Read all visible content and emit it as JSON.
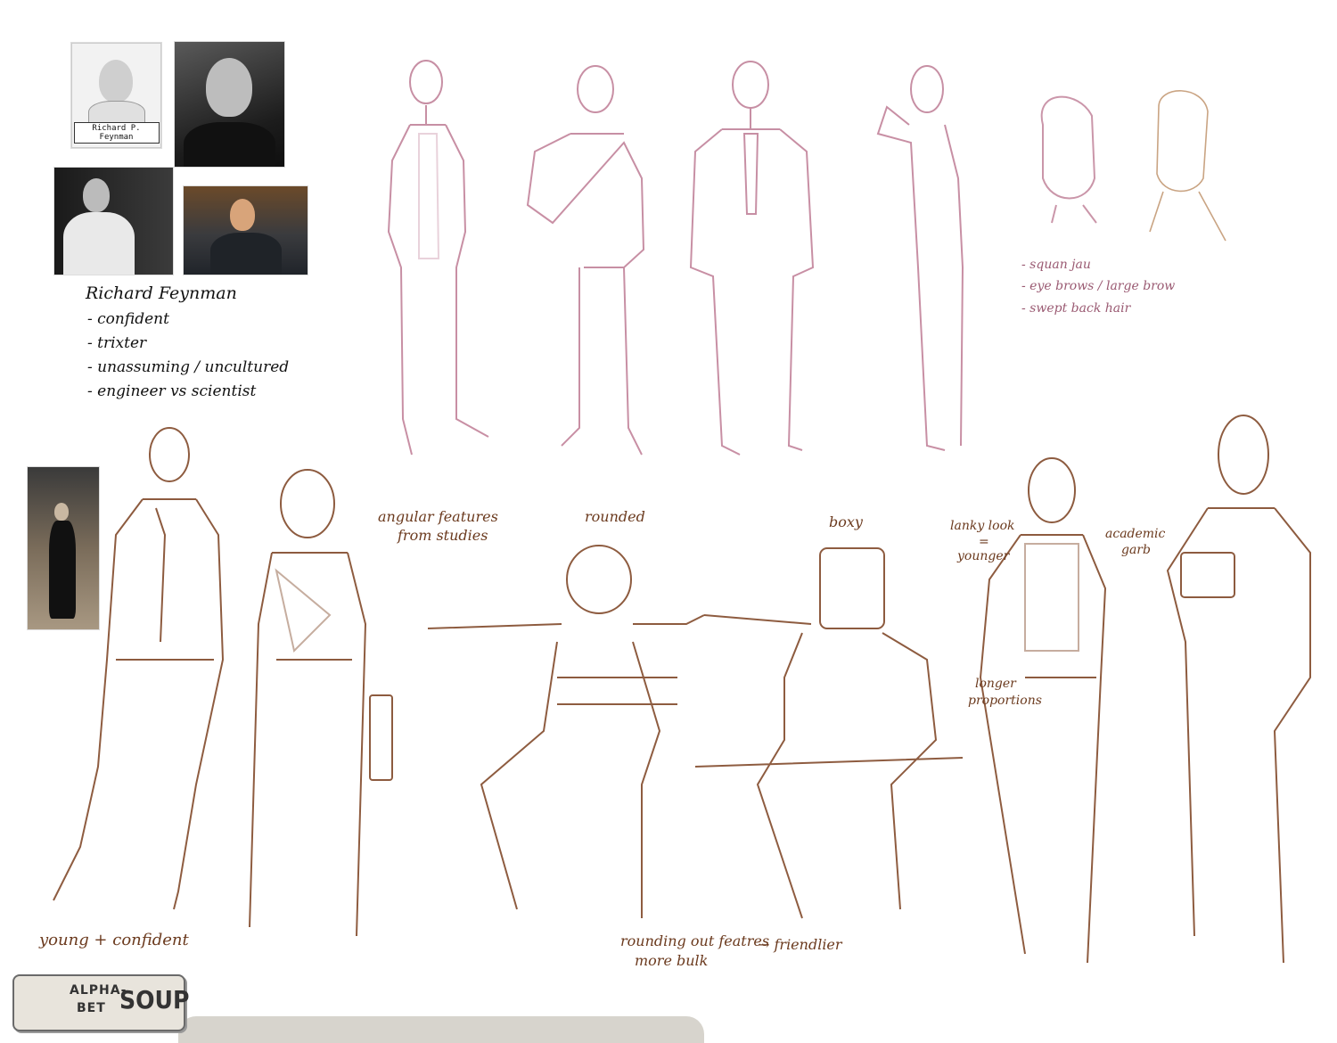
{
  "references": {
    "mugshot_caption": "Richard P. Feynman"
  },
  "notes_black": {
    "title": "Richard Feynman",
    "items": [
      "- confident",
      "- trixter",
      "- unassuming / uncultured",
      "- engineer vs scientist"
    ]
  },
  "notes_red": {
    "items": [
      "- squan jau",
      "- eye brows / large brow",
      "- swept back hair"
    ]
  },
  "notes_brown": {
    "young_confident": "young + confident",
    "angular": "angular features",
    "angular_2": "from studies",
    "rounded": "rounded",
    "boxy": "boxy",
    "lanky": "lanky look",
    "lanky_eq": "=",
    "lanky_2": "younger",
    "academic": "academic",
    "academic_2": "garb",
    "longer": "longer",
    "longer_2": "proportions",
    "rounding": "rounding out featres",
    "rounding_2": "more bulk",
    "friendlier": "→ friendlier"
  },
  "logo": {
    "alpha": "ALPHA-",
    "bet": "BET",
    "soup": "SOUP"
  },
  "colors": {
    "red_sketch": "#b56a86",
    "brown_sketch": "#7a3f1e",
    "ink": "#111111"
  }
}
